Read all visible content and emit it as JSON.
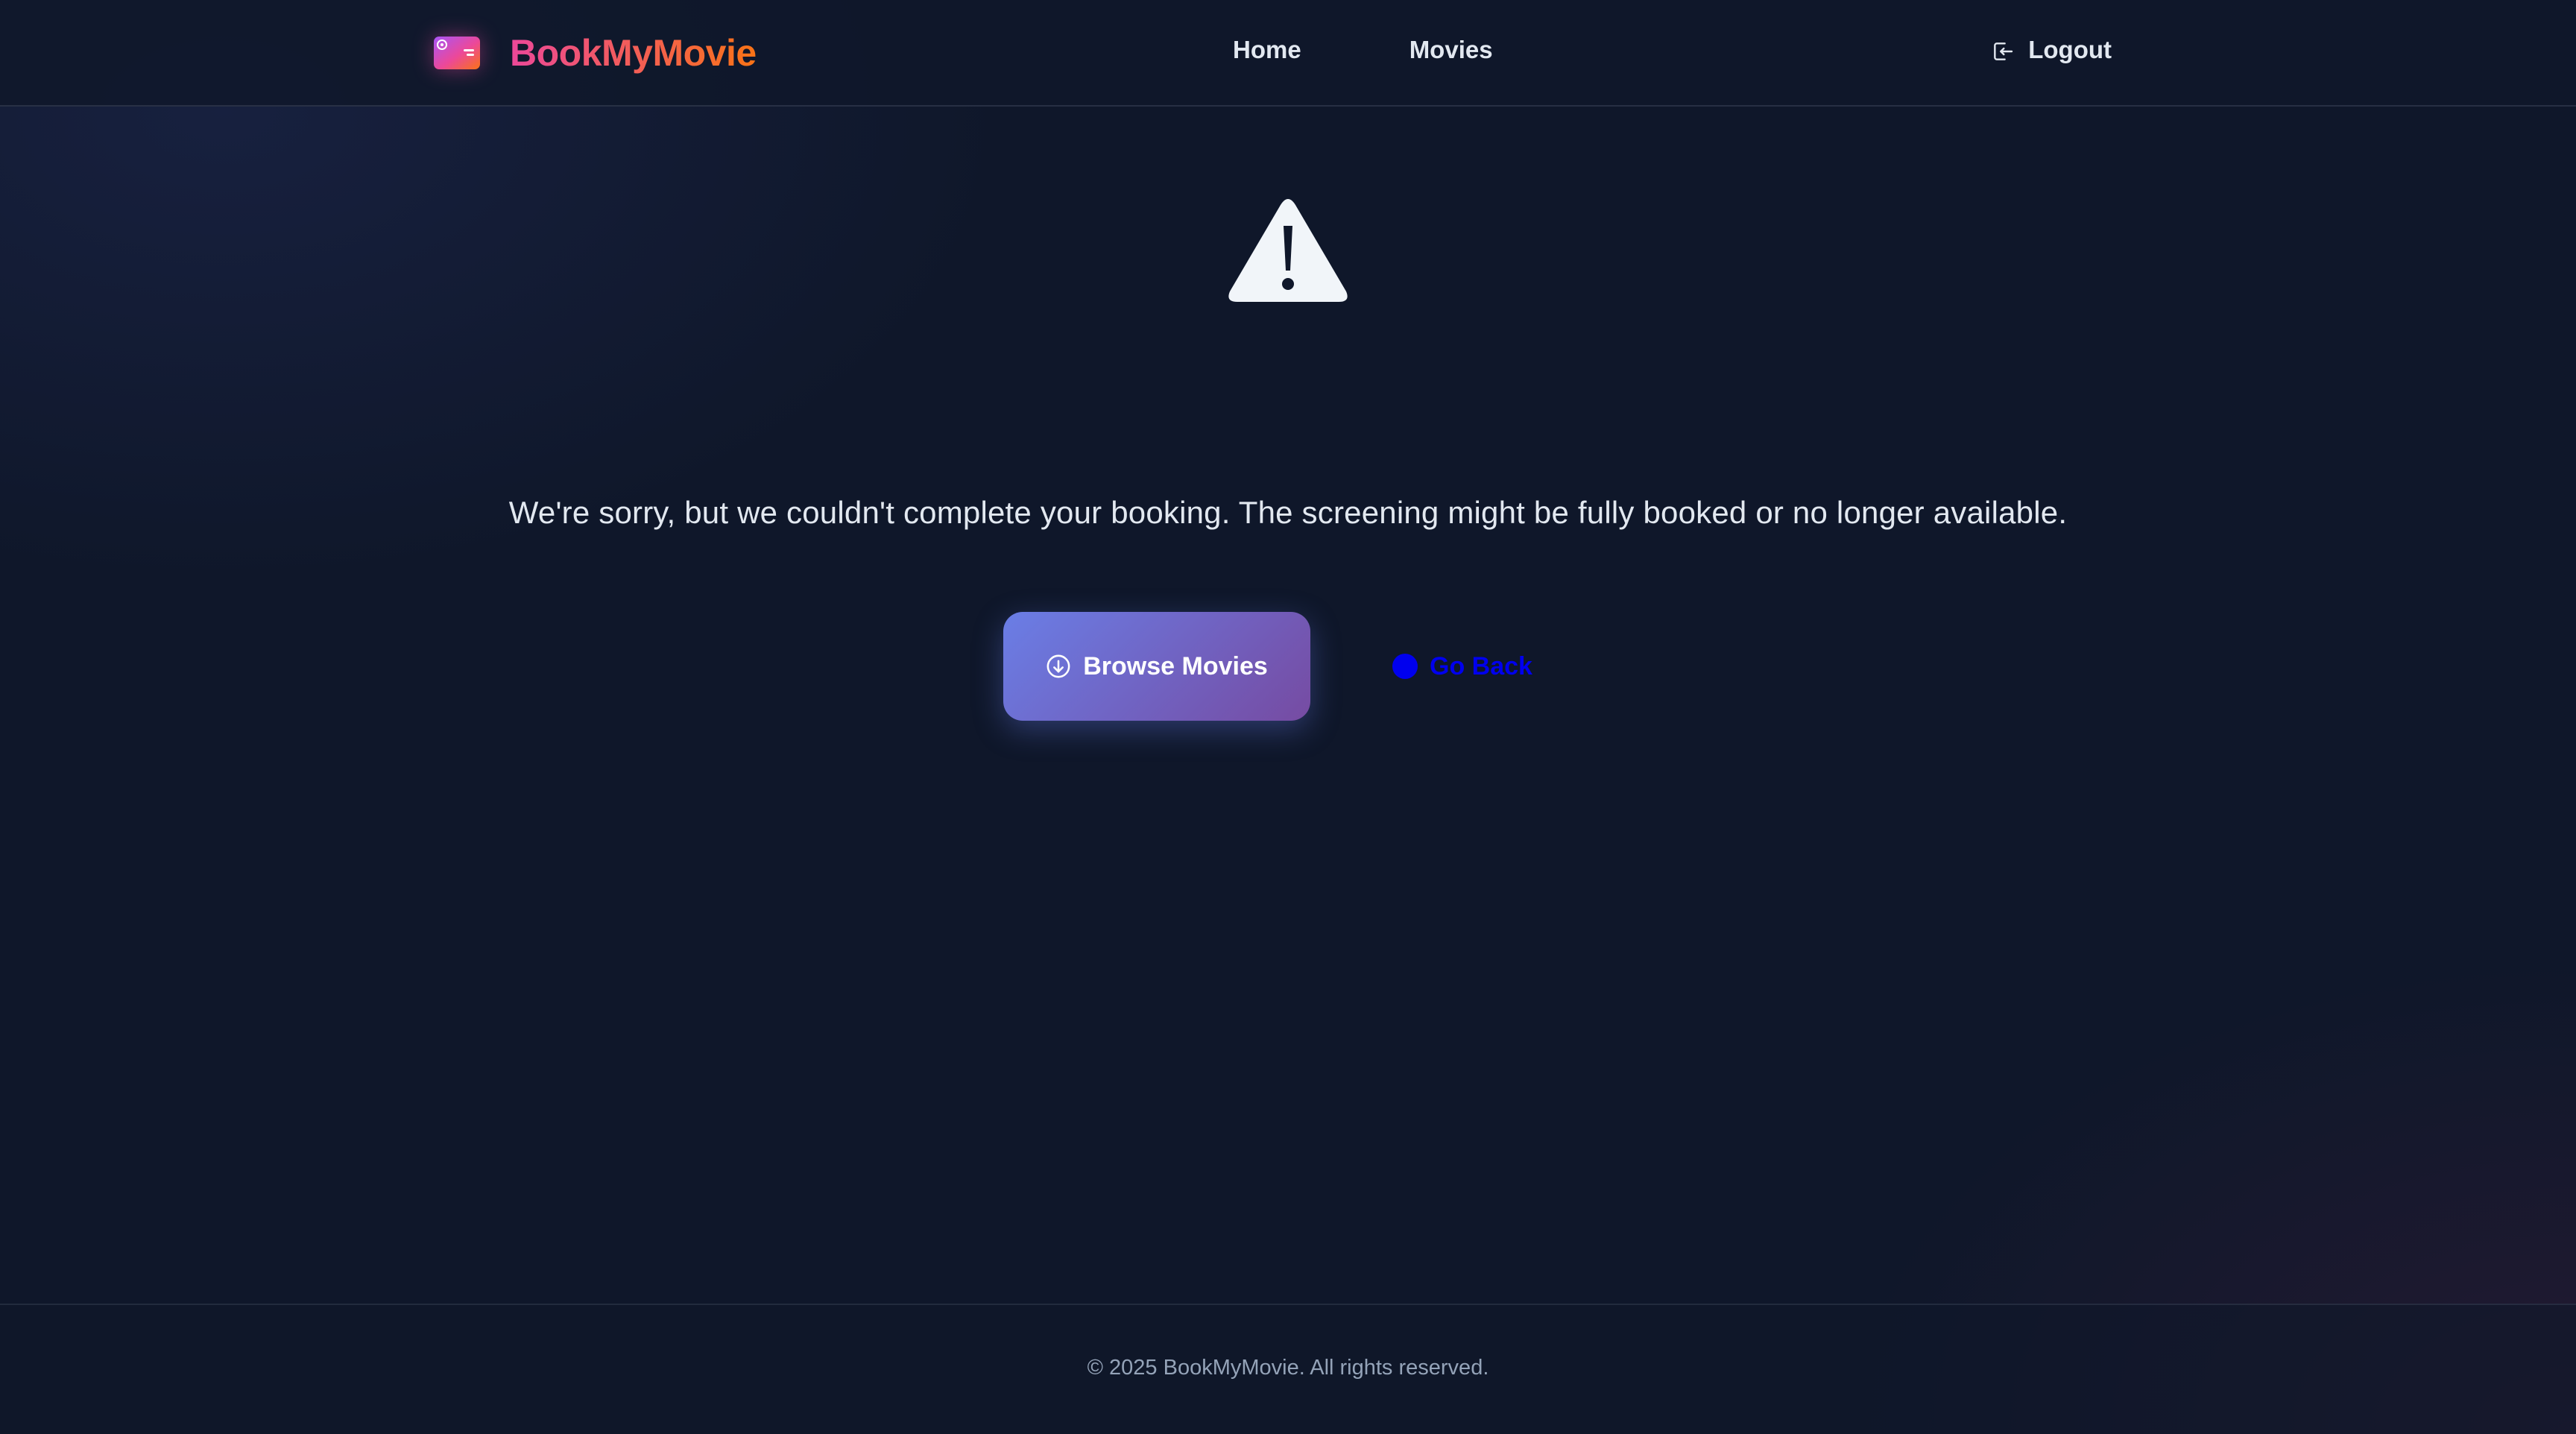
{
  "header": {
    "brand_name": "BookMyMovie",
    "nav": {
      "home_label": "Home",
      "movies_label": "Movies"
    },
    "logout_label": "Logout"
  },
  "main": {
    "message": "We're sorry, but we couldn't complete your booking. The screening might be fully booked or no longer available.",
    "browse_button_label": "Browse Movies",
    "back_button_label": "Go Back"
  },
  "footer": {
    "copyright": "© 2025 BookMyMovie. All rights reserved."
  },
  "icons": {
    "brand": "ticket-icon",
    "logout": "logout-icon",
    "warning": "warning-triangle-icon",
    "browse": "arrow-down-circle-icon",
    "back": "back-arrow-icon"
  },
  "colors": {
    "background": "#0f172a",
    "brand_gradient_start": "#ec4899",
    "brand_gradient_end": "#f97316",
    "primary_gradient_start": "#6a7ee6",
    "primary_gradient_end": "#764ba2",
    "back_link": "#0000ee",
    "text": "#e2e8f0",
    "muted_text": "#94a3b8"
  }
}
